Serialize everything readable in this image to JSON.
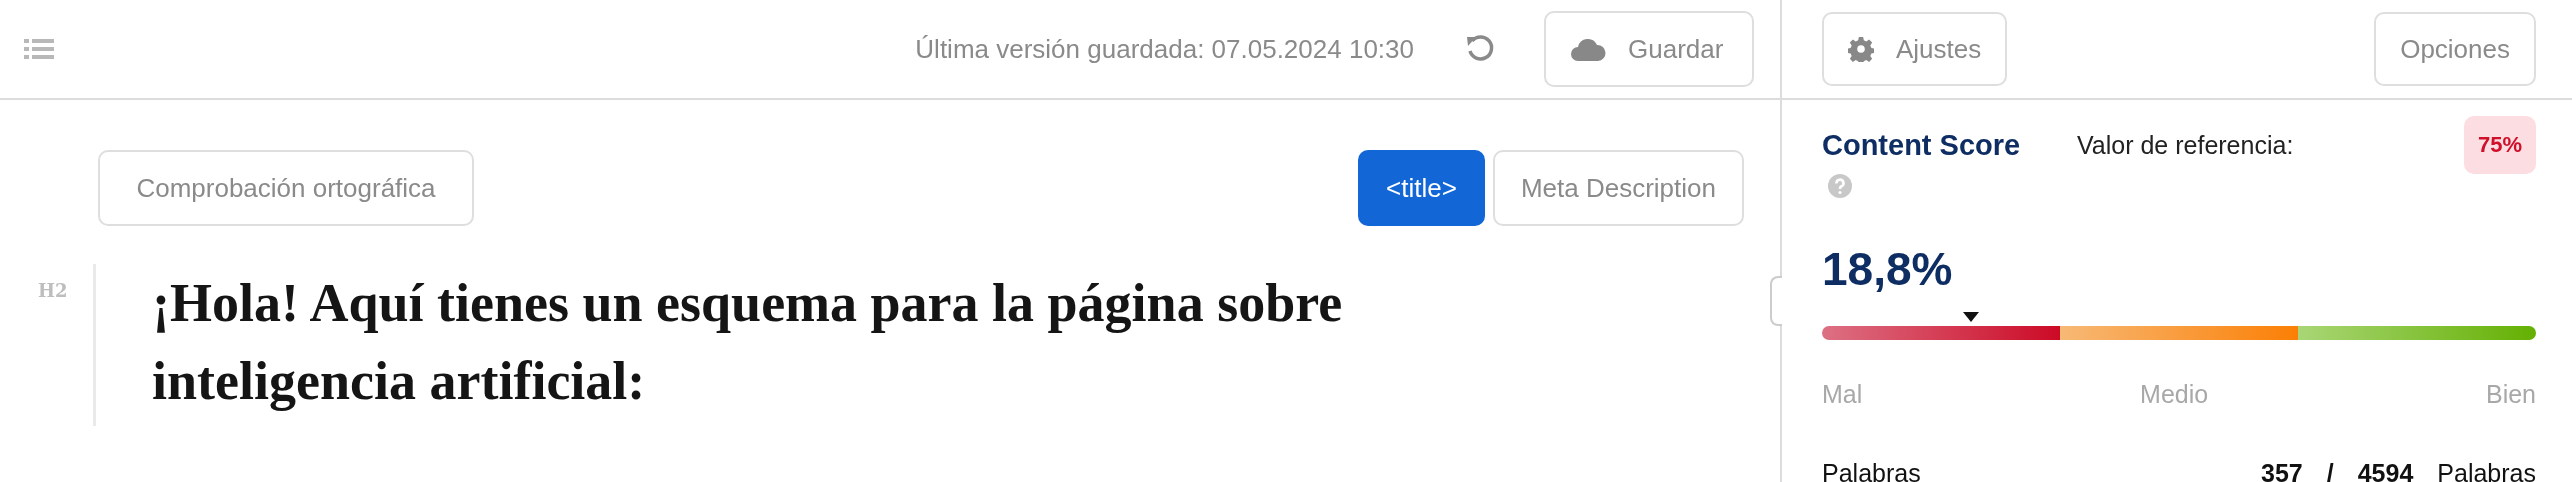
{
  "toolbar": {
    "saved_text": "Última versión guardada: 07.05.2024 10:30",
    "save_button": "Guardar"
  },
  "editor": {
    "spellcheck_button": "Comprobación ortográfica",
    "tabs": [
      {
        "label": "<title>",
        "selected": true
      },
      {
        "label": "Meta Description",
        "selected": false
      }
    ],
    "heading": {
      "tag": "H2",
      "text": "¡Hola! Aquí tienes un esquema para la página sobre inteligencia artificial:"
    }
  },
  "sidebar": {
    "settings_button": "Ajustes",
    "options_button": "Opciones",
    "title": "Content Score",
    "reference_label": "Valor de referencia:",
    "reference_value": "75%",
    "score": "18,8%",
    "scale_labels": [
      "Mal",
      "Medio",
      "Bien"
    ],
    "words": {
      "label": "Palabras",
      "count": "357",
      "separator": "/",
      "target": "4594",
      "unit": "Palabras"
    }
  }
}
